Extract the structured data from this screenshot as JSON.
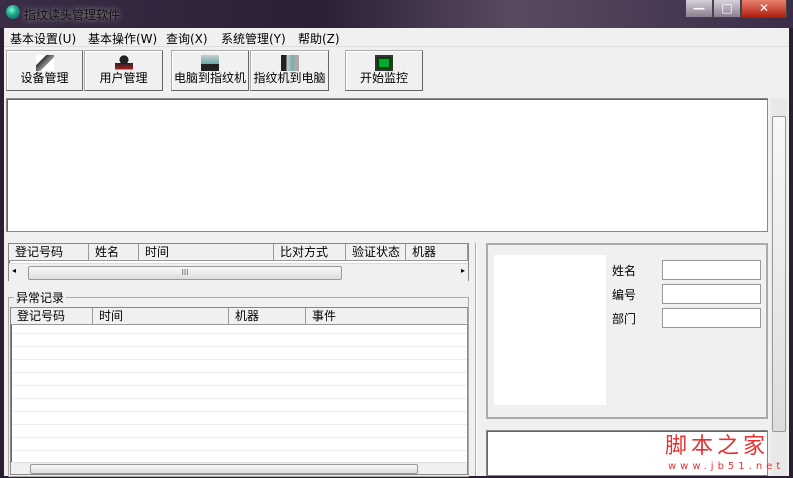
{
  "window": {
    "title": "指纹读头管理软件",
    "min": "—",
    "max": "□",
    "close": "✕"
  },
  "menu": [
    "基本设置(U)",
    "基本操作(W)",
    "查询(X)",
    "系统管理(Y)",
    "帮助(Z)"
  ],
  "toolbar": [
    {
      "label": "设备管理",
      "icon": "device-icon"
    },
    {
      "label": "用户管理",
      "icon": "user-icon"
    },
    {
      "label": "电脑到指纹机",
      "icon": "pc-to-device-icon"
    },
    {
      "label": "指纹机到电脑",
      "icon": "device-to-pc-icon"
    },
    {
      "label": "开始监控",
      "icon": "monitor-icon"
    }
  ],
  "records": {
    "columns": [
      "登记号码",
      "姓名",
      "时间",
      "比对方式",
      "验证状态",
      "机器"
    ],
    "scroll_grip": "III"
  },
  "exceptions": {
    "title": "异常记录",
    "columns": [
      "登记号码",
      "时间",
      "机器",
      "事件"
    ]
  },
  "user_info": {
    "name_label": "姓名",
    "id_label": "编号",
    "dept_label": "部门",
    "name": "",
    "id": "",
    "dept": ""
  },
  "watermark": {
    "text": "脚本之家",
    "url": "www.jb51.net"
  },
  "colors": {
    "watermark": "#e83030"
  }
}
